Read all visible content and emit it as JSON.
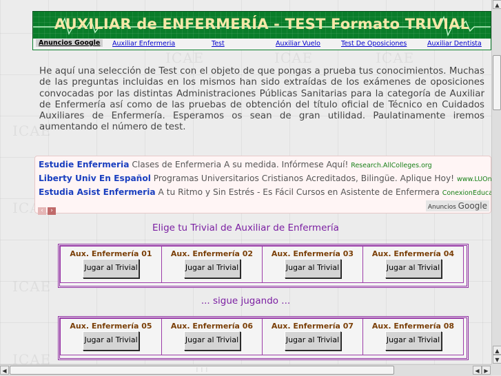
{
  "header": {
    "title": "AUXILIAR de ENFERMERÍA - TEST Formato TRIVIAL"
  },
  "nav": {
    "ads_label": "Anuncios Google",
    "links": [
      "Auxiliar Enfermeria",
      "Test",
      "Auxiliar Vuelo",
      "Test De Oposiciones",
      "Auxiliar Dentista"
    ]
  },
  "intro": {
    "text": "He aquí una selección de Test con el objeto de que pongas a prueba tus conocimientos. Muchas de las preguntas incluidas en los mismos han sido extraídas de los exámenes de oposiciones convocadas por las distintas Administraciones Públicas Sanitarias para la categoría de Auxiliar de Enfermería así como de las pruebas de obtención del título oficial de Técnico en Cuidados Auxiliares de Enfermería. Esperamos os sean de gran utilidad. Paulatinamente iremos aumentando el número de test."
  },
  "ads": {
    "items": [
      {
        "title": "Estudie Enfermeria",
        "text": "Clases de Enfermeria A su medida. Infórmese Aquí!",
        "url": "Research.AllColleges.org"
      },
      {
        "title": "Liberty Univ En Español",
        "text": "Programas Universitarios Cristianos Acreditados, Bilingüe. Aplique Hoy!",
        "url": "www.LUOnline.com"
      },
      {
        "title": "Estudia Asist Enfermeria",
        "text": "A tu Ritmo y Sin Estrés - Es Fácil Cursos en Asistente de Enfermera",
        "url": "ConexionEducacion.c..."
      }
    ],
    "prev_icon": "‹",
    "next_icon": "›",
    "badge_small": "Anuncios",
    "badge_brand": "Google"
  },
  "sections": {
    "choose_title": "Elige tu Trivial de Auxiliar de Enfermería",
    "continue_title": "... sigue jugando ..."
  },
  "trivials": {
    "row1": [
      {
        "title": "Aux. Enfermería 01",
        "button": "Jugar al Trivial"
      },
      {
        "title": "Aux. Enfermería 02",
        "button": "Jugar al Trivial"
      },
      {
        "title": "Aux. Enfermería 03",
        "button": "Jugar al Trivial"
      },
      {
        "title": "Aux. Enfermería 04",
        "button": "Jugar al Trivial"
      }
    ],
    "row2": [
      {
        "title": "Aux. Enfermería 05",
        "button": "Jugar al Trivial"
      },
      {
        "title": "Aux. Enfermería 06",
        "button": "Jugar al Trivial"
      },
      {
        "title": "Aux. Enfermería 07",
        "button": "Jugar al Trivial"
      },
      {
        "title": "Aux. Enfermería 08",
        "button": "Jugar al Trivial"
      }
    ]
  },
  "watermark": "ICAE",
  "colors": {
    "banner": "#0a7d2a",
    "banner_text": "#f5e7a8",
    "accent_purple": "#7b1fa2",
    "link_blue": "#0000cc"
  }
}
